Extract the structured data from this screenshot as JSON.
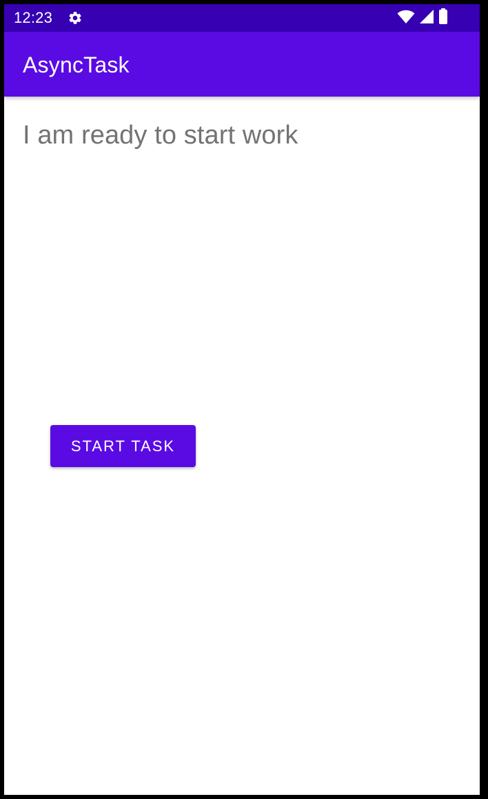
{
  "status_bar": {
    "time": "12:23",
    "icons": [
      "settings-gear-icon",
      "wifi-icon",
      "cellular-signal-icon",
      "battery-icon"
    ],
    "background_color": "#3700b3"
  },
  "app_bar": {
    "title": "AsyncTask",
    "background_color": "#5a0be4"
  },
  "main": {
    "status_message": "I am ready to start work",
    "start_button_label": "START TASK",
    "accent_color": "#5a0be4",
    "text_color": "#737373"
  }
}
